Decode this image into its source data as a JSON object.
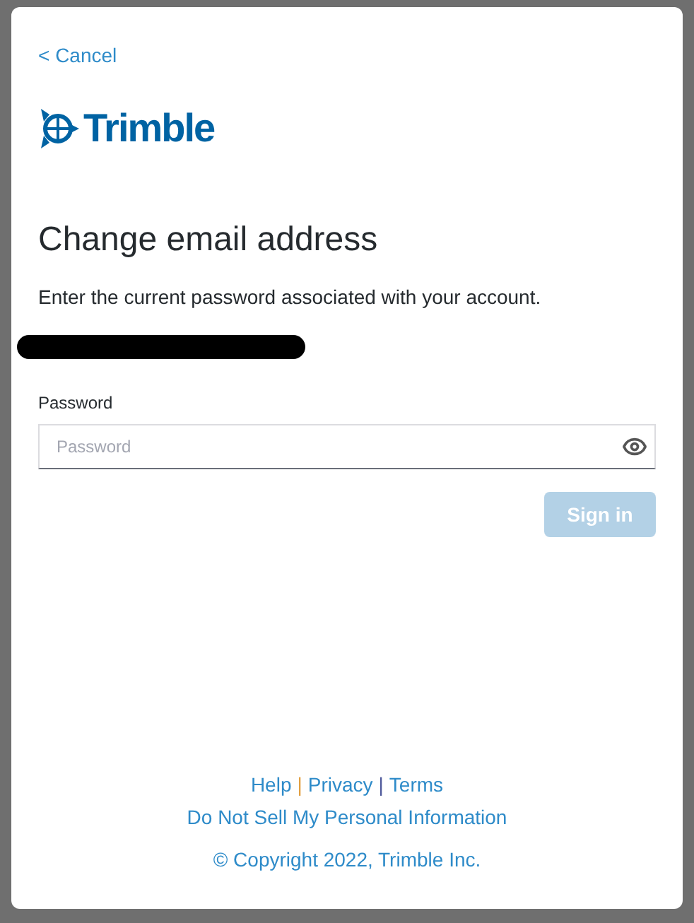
{
  "cancel_link": "< Cancel",
  "logo": {
    "text": "Trimble"
  },
  "heading": "Change email address",
  "instructions": "Enter the current password associated with your account.",
  "password": {
    "label": "Password",
    "placeholder": "Password"
  },
  "sign_in_button": {
    "label": "Sign in",
    "disabled": true
  },
  "footer": {
    "links": [
      {
        "label": "Help"
      },
      {
        "label": "Privacy"
      },
      {
        "label": "Terms"
      }
    ],
    "separators": [
      "|",
      "|"
    ],
    "privacy_link": "Do Not Sell My Personal Information",
    "copyright": "© Copyright 2022, Trimble Inc."
  }
}
